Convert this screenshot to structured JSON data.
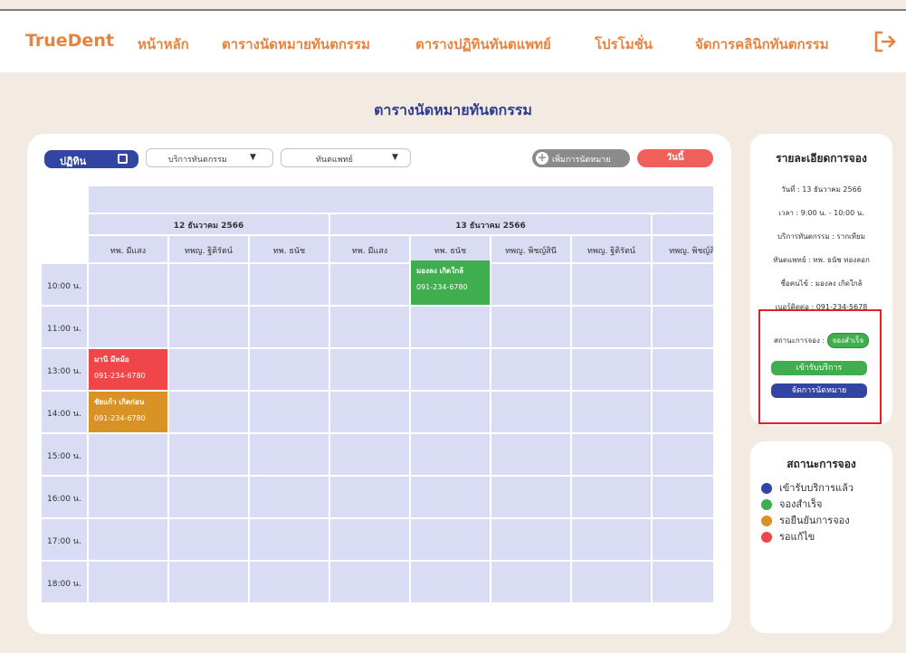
{
  "nav": {
    "brand": "TrueDent",
    "links": [
      "หน้าหลัก",
      "ตารางนัดหมายทันตกรรม",
      "ตารางปฏิทินทันตแพทย์",
      "โปรโมชั่น",
      "จัดการคลินิกทันตกรรม"
    ]
  },
  "page_title": "ตารางนัดหมายทันตกรรม",
  "toolbar": {
    "calendar_label": "ปฏิทิน",
    "service_select": "บริการทันตกรรม",
    "dentist_select": "ทันตแพทย์",
    "add_label": "เพิ่มการนัดหมาย",
    "today_label": "วันนี้"
  },
  "schedule": {
    "dates": [
      "12 ธันวาคม 2566",
      "13 ธันวาคม 2566"
    ],
    "dentists": [
      "ทพ. มีแสง",
      "ทพญ. ฐิติรัตน์",
      "ทพ. ธนัช",
      "ทพ. มีแสง",
      "ทพ. ธนัช",
      "ทพญ. พิชญ์สินี",
      "ทพญ. ฐิติรัตน์",
      "ทพญ. พิชญ์สิ"
    ],
    "times": [
      "10:00 น.",
      "11:00 น.",
      "13:00 น.",
      "14:00 น.",
      "15:00 น.",
      "16:00 น.",
      "17:00 น.",
      "18:00 น."
    ],
    "appointments": [
      {
        "name": "มองลง เกิดใกล้",
        "phone": "091-234-6780",
        "status": "green"
      },
      {
        "name": "มานี มีหม้อ",
        "phone": "091-234-6780",
        "status": "red"
      },
      {
        "name": "ชัยแก้ว เกิดก่อน",
        "phone": "091-234-6780",
        "status": "orange"
      }
    ]
  },
  "details": {
    "title": "รายละเอียดการจอง",
    "date": "วันที่ : 13 ธันวาคม 2566",
    "time": "เวลา : 9:00 น. - 10:00 น.",
    "service": "บริการทันตกรรม : รากเทียม",
    "dentist": "ทันตแพทย์ : ทพ. ธนัช ทองลอก",
    "patient": "ชื่อคนไข้ : มองลง เกิดใกล้",
    "contact": "เบอร์ติดต่อ : 091-234-5678",
    "status_label": "สถานะการจอง :",
    "status_badge": "จองสำเร็จ",
    "checkin_btn": "เข้ารับบริการ",
    "manage_btn": "จัดการนัดหมาย"
  },
  "legend": {
    "title": "สถานะการจอง",
    "items": [
      {
        "label": "เข้ารับบริการแล้ว",
        "color": "#3345a3"
      },
      {
        "label": "จองสำเร็จ",
        "color": "#40ad4f"
      },
      {
        "label": "รอยืนยันการจอง",
        "color": "#d99225"
      },
      {
        "label": "รอแก้ไข",
        "color": "#f0464a"
      }
    ]
  }
}
